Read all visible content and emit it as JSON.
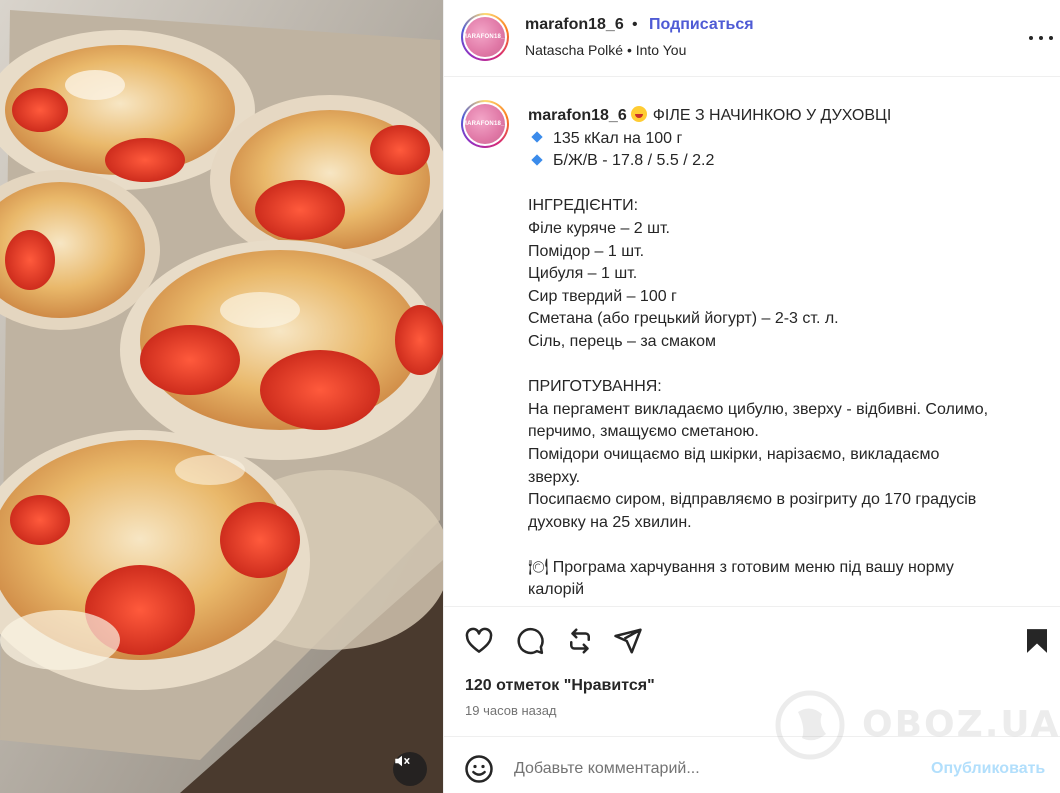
{
  "media": {
    "description_icon": "mute-icon"
  },
  "header": {
    "username": "marafon18_6",
    "dot": "•",
    "follow_label": "Подписаться",
    "audio": "Natascha Polké • Into You",
    "avatar_text": "MARAFON18_6"
  },
  "caption": {
    "username": "marafon18_6",
    "title": "ФІЛЕ З НАЧИНКОЮ У ДУХОВЦІ",
    "lines": [
      "135 кКал на 100 г",
      "Б/Ж/В - 17.8 / 5.5 / 2.2",
      "",
      "ІНГРЕДІЄНТИ:",
      "Філе куряче – 2 шт.",
      "Помідор – 1 шт.",
      "Цибуля – 1 шт.",
      "Сир твердий – 100 г",
      "Сметана (або грецький йогурт) – 2-3 ст. л.",
      "Сіль, перець – за смаком",
      "",
      "ПРИГОТУВАННЯ:",
      "На пергамент викладаємо цибулю, зверху - відбивні. Солимо,",
      "перчимо, змащуємо сметаною.",
      "Помідори очищаємо від шкірки, нарізаємо, викладаємо",
      "зверху.",
      "Посипаємо сиром, відправляємо в розігриту до 170 градусів",
      "духовку на 25 хвилин.",
      "",
      "🍽 Програма харчування з готовим меню під вашу норму",
      "калорій"
    ]
  },
  "actions": {
    "icons": [
      "heart-icon",
      "comment-icon",
      "repost-icon",
      "share-icon",
      "save-icon"
    ],
    "likes": "120 отметок \"Нравится\"",
    "time": "19 часов назад"
  },
  "comment": {
    "placeholder": "Добавьте комментарий...",
    "post_label": "Опубликовать"
  },
  "watermark": {
    "text": "OBOZ.UA"
  },
  "colors": {
    "follow": "#4f5bd5",
    "post_disabled": "#b2dffc",
    "secondary_text": "#737373",
    "divider": "#efefef"
  }
}
